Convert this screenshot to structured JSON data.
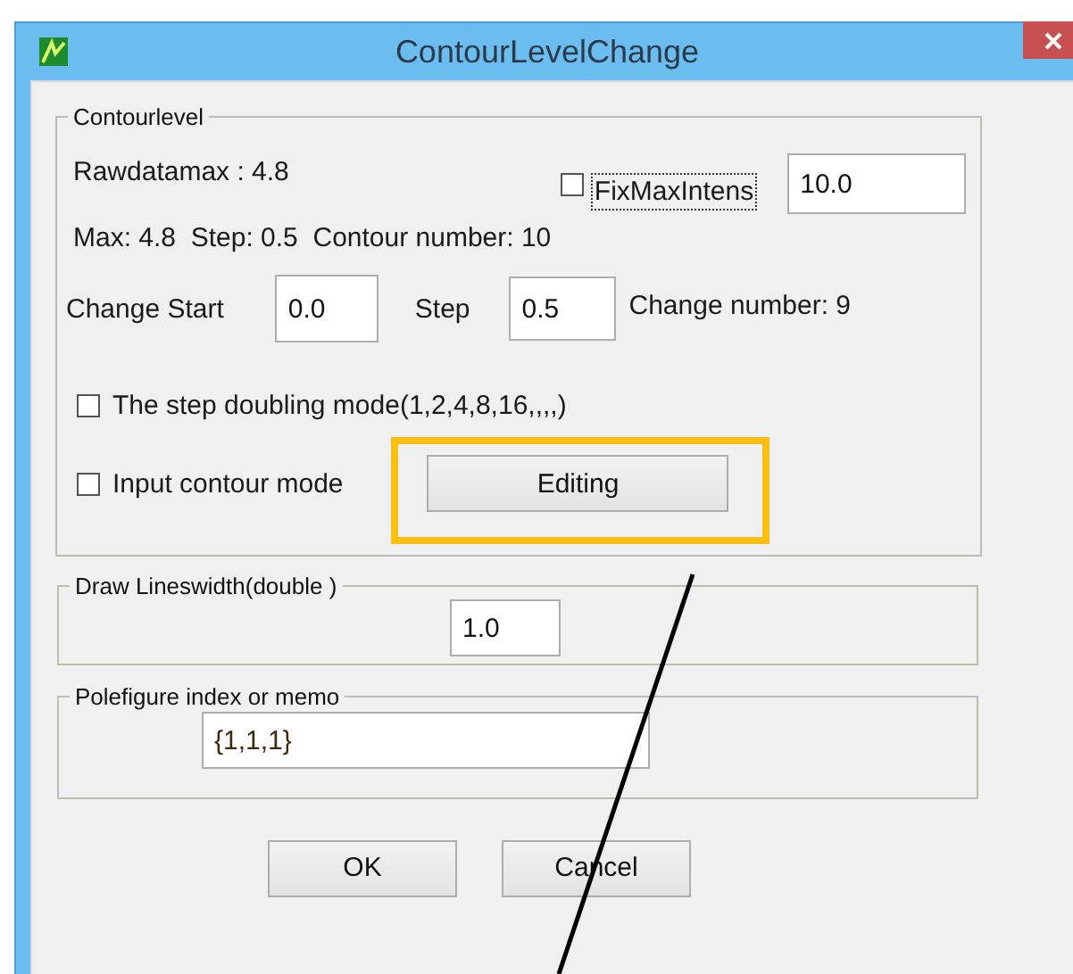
{
  "window": {
    "title": "ContourLevelChange"
  },
  "contour_level": {
    "legend": "Contourlevel",
    "rawdatamax": "Rawdatamax : 4.8",
    "fix_max_intens": {
      "label": "FixMaxIntens",
      "checked": false,
      "focused": true
    },
    "max_intens_value": "10.0",
    "summary": "Max: 4.8  Step: 0.5  Contour number: 10",
    "change_start": {
      "label": "Change Start",
      "value": "0.0"
    },
    "step": {
      "label": "Step",
      "value": "0.5"
    },
    "change_number": "Change number: 9",
    "step_doubling": {
      "label": "The step doubling mode(1,2,4,8,16,,,,)",
      "checked": false
    },
    "input_contour": {
      "label": "Input contour mode",
      "checked": false
    },
    "editing_button": {
      "label": "Editing",
      "highlighted": true
    }
  },
  "line_width": {
    "legend": "Draw Lineswidth(double )",
    "value": "1.0"
  },
  "memo": {
    "legend": "Polefigure index or memo",
    "value": "{1,1,1}"
  },
  "buttons": [
    "OK",
    "Cancel"
  ],
  "annotation": {
    "pointer_line": true
  }
}
